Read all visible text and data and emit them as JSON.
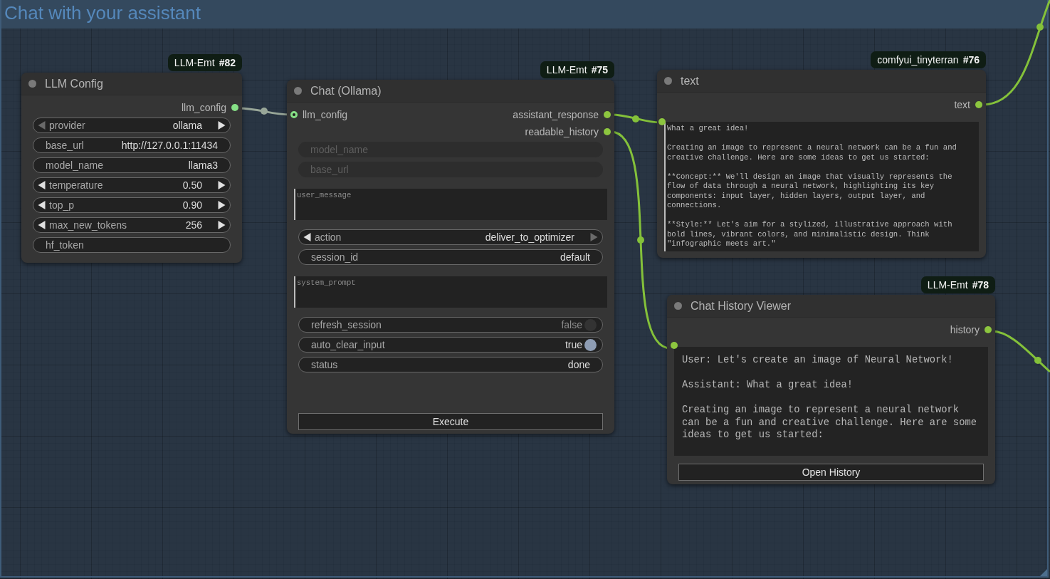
{
  "group": {
    "title": "Chat with your assistant"
  },
  "nodes": [
    {
      "title": "LLM Config",
      "badge": {
        "source": "LLM-Emt",
        "id": "#82"
      },
      "outputs": [
        {
          "label": "llm_config",
          "color": "#86e086"
        }
      ],
      "widgets": [
        {
          "kind": "combo",
          "label": "provider",
          "value": "ollama",
          "prev_disabled": true,
          "next_disabled": false
        },
        {
          "kind": "text",
          "label": "base_url",
          "value": "http://127.0.0.1:11434"
        },
        {
          "kind": "text",
          "label": "model_name",
          "value": "llama3"
        },
        {
          "kind": "number",
          "label": "temperature",
          "value": "0.50",
          "prev_disabled": false,
          "next_disabled": false
        },
        {
          "kind": "number",
          "label": "top_p",
          "value": "0.90",
          "prev_disabled": false,
          "next_disabled": false
        },
        {
          "kind": "number",
          "label": "max_new_tokens",
          "value": "256",
          "prev_disabled": false,
          "next_disabled": false
        },
        {
          "kind": "text",
          "label": "hf_token"
        }
      ]
    },
    {
      "title": "Chat (Ollama)",
      "badge": {
        "source": "LLM-Emt",
        "id": "#75"
      },
      "inputs": [
        {
          "label": "llm_config",
          "color": "#86e086"
        }
      ],
      "outputs": [
        {
          "label": "assistant_response",
          "color": "#8dc63f"
        },
        {
          "label": "readable_history",
          "color": "#8dc63f"
        }
      ],
      "widgets": [
        {
          "kind": "converted",
          "label": "model_name"
        },
        {
          "kind": "converted",
          "label": "base_url"
        },
        {
          "kind": "textarea",
          "placeholder": "user_message",
          "linked": false
        },
        {
          "kind": "combo",
          "label": "action",
          "value": "deliver_to_optimizer",
          "prev_disabled": false,
          "next_disabled": true
        },
        {
          "kind": "text",
          "label": "session_id",
          "value": "default"
        },
        {
          "kind": "textarea",
          "placeholder": "system_prompt",
          "linked": false
        },
        {
          "kind": "toggle",
          "label": "refresh_session",
          "value": "false",
          "on": false
        },
        {
          "kind": "toggle",
          "label": "auto_clear_input",
          "value": "true",
          "on": true
        },
        {
          "kind": "text",
          "label": "status",
          "value": "done"
        },
        {
          "kind": "button",
          "label": "Execute"
        }
      ]
    },
    {
      "title": "text",
      "badge": {
        "source": "comfyui_tinyterran",
        "id": "#76"
      },
      "outputs": [
        {
          "label": "text",
          "color": "#8dc63f"
        }
      ],
      "widgets": [
        {
          "kind": "textarea",
          "value": "What a great idea!\n\nCreating an image to represent a neural network can be a fun and creative challenge. Here are some ideas to get us started:\n\n**Concept:** We'll design an image that visually represents the flow of data through a neural network, highlighting its key components: input layer, hidden layers, output layer, and connections.\n\n**Style:** Let's aim for a stylized, illustrative approach with bold lines, vibrant colors, and minimalistic design. Think \"infographic meets art.\"",
          "linked": true
        }
      ]
    },
    {
      "title": "Chat History Viewer",
      "badge": {
        "source": "LLM-Emt",
        "id": "#78"
      },
      "outputs": [
        {
          "label": "history",
          "color": "#8dc63f"
        }
      ],
      "widgets": [
        {
          "kind": "display",
          "value": "User: Let's create an image of Neural Network!\n\nAssistant: What a great idea!\n\nCreating an image to represent a neural network can be a fun and creative challenge. Here are some ideas to get us started:",
          "linked": true
        },
        {
          "kind": "button",
          "label": "Open History"
        }
      ]
    }
  ]
}
